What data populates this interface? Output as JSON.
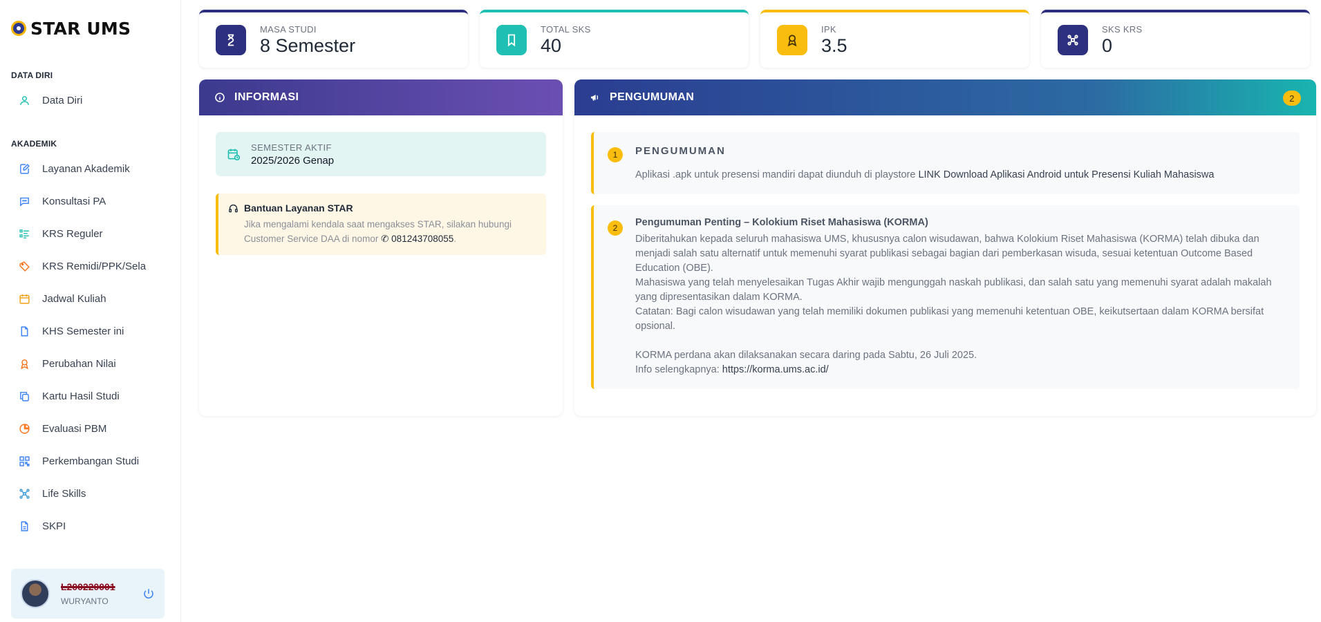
{
  "brand": {
    "name": "STAR UMS"
  },
  "sidebar": {
    "sections": [
      {
        "title": "DATA DIRI",
        "items": [
          {
            "label": "Data Diri",
            "icon": "user-icon"
          }
        ]
      },
      {
        "title": "AKADEMIK",
        "items": [
          {
            "label": "Layanan Akademik",
            "icon": "edit-document-icon"
          },
          {
            "label": "Konsultasi PA",
            "icon": "chat-icon"
          },
          {
            "label": "KRS Reguler",
            "icon": "list-check-icon"
          },
          {
            "label": "KRS Remidi/PPK/Sela",
            "icon": "tag-icon"
          },
          {
            "label": "Jadwal Kuliah",
            "icon": "calendar-icon"
          },
          {
            "label": "KHS Semester ini",
            "icon": "file-icon"
          },
          {
            "label": "Perubahan Nilai",
            "icon": "award-icon"
          },
          {
            "label": "Kartu Hasil Studi",
            "icon": "copy-icon"
          },
          {
            "label": "Evaluasi PBM",
            "icon": "pie-chart-icon"
          },
          {
            "label": "Perkembangan Studi",
            "icon": "qr-grid-icon"
          },
          {
            "label": "Life Skills",
            "icon": "molecule-icon"
          },
          {
            "label": "SKPI",
            "icon": "document-icon"
          }
        ]
      }
    ],
    "user": {
      "nim": "L200220001",
      "name": "WURYANTO"
    }
  },
  "stats": [
    {
      "label": "MASA STUDI",
      "value": "8 Semester",
      "color": "#2d2f7f",
      "icon": "hourglass-icon"
    },
    {
      "label": "TOTAL SKS",
      "value": "40",
      "color": "#1fbfb3",
      "icon": "bookmark-icon"
    },
    {
      "label": "IPK",
      "value": "3.5",
      "color": "#f8bd0e",
      "icon": "award-icon"
    },
    {
      "label": "SKS KRS",
      "value": "0",
      "color": "#2d2f7f",
      "icon": "molecule-icon"
    }
  ],
  "info": {
    "title": "INFORMASI",
    "semester_label": "SEMESTER AKTIF",
    "semester_value": "2025/2026 Genap",
    "help_title": "Bantuan Layanan STAR",
    "help_text": "Jika mengalami kendala saat mengakses STAR, silakan hubungi Customer Service DAA di nomor",
    "help_phone": "081243708055",
    "help_end": "."
  },
  "announcements": {
    "title": "PENGUMUMAN",
    "count": "2",
    "items": [
      {
        "num": "1",
        "title": "PENGUMUMAN",
        "text": "Aplikasi .apk untuk presensi mandiri dapat diunduh di playstore",
        "link": "LINK Download Aplikasi Android untuk Presensi Kuliah Mahasiswa"
      },
      {
        "num": "2",
        "title": "Pengumuman Penting – Kolokium Riset Mahasiswa (KORMA)",
        "p1": "Diberitahukan kepada seluruh mahasiswa UMS, khususnya calon wisudawan, bahwa Kolokium Riset Mahasiswa (KORMA) telah dibuka dan menjadi salah satu alternatif untuk memenuhi syarat publikasi sebagai bagian dari pemberkasan wisuda, sesuai ketentuan Outcome Based Education (OBE).",
        "p2": "Mahasiswa yang telah menyelesaikan Tugas Akhir wajib mengunggah naskah publikasi, dan salah satu yang memenuhi syarat adalah makalah yang dipresentasikan dalam KORMA.",
        "p3": "Catatan: Bagi calon wisudawan yang telah memiliki dokumen publikasi yang memenuhi ketentuan OBE, keikutsertaan dalam KORMA bersifat opsional.",
        "p4": "KORMA perdana akan dilaksanakan secara daring pada Sabtu, 26 Juli 2025.",
        "p5_label": "Info selengkapnya:",
        "p5_link": "https://korma.ums.ac.id/"
      }
    ]
  }
}
